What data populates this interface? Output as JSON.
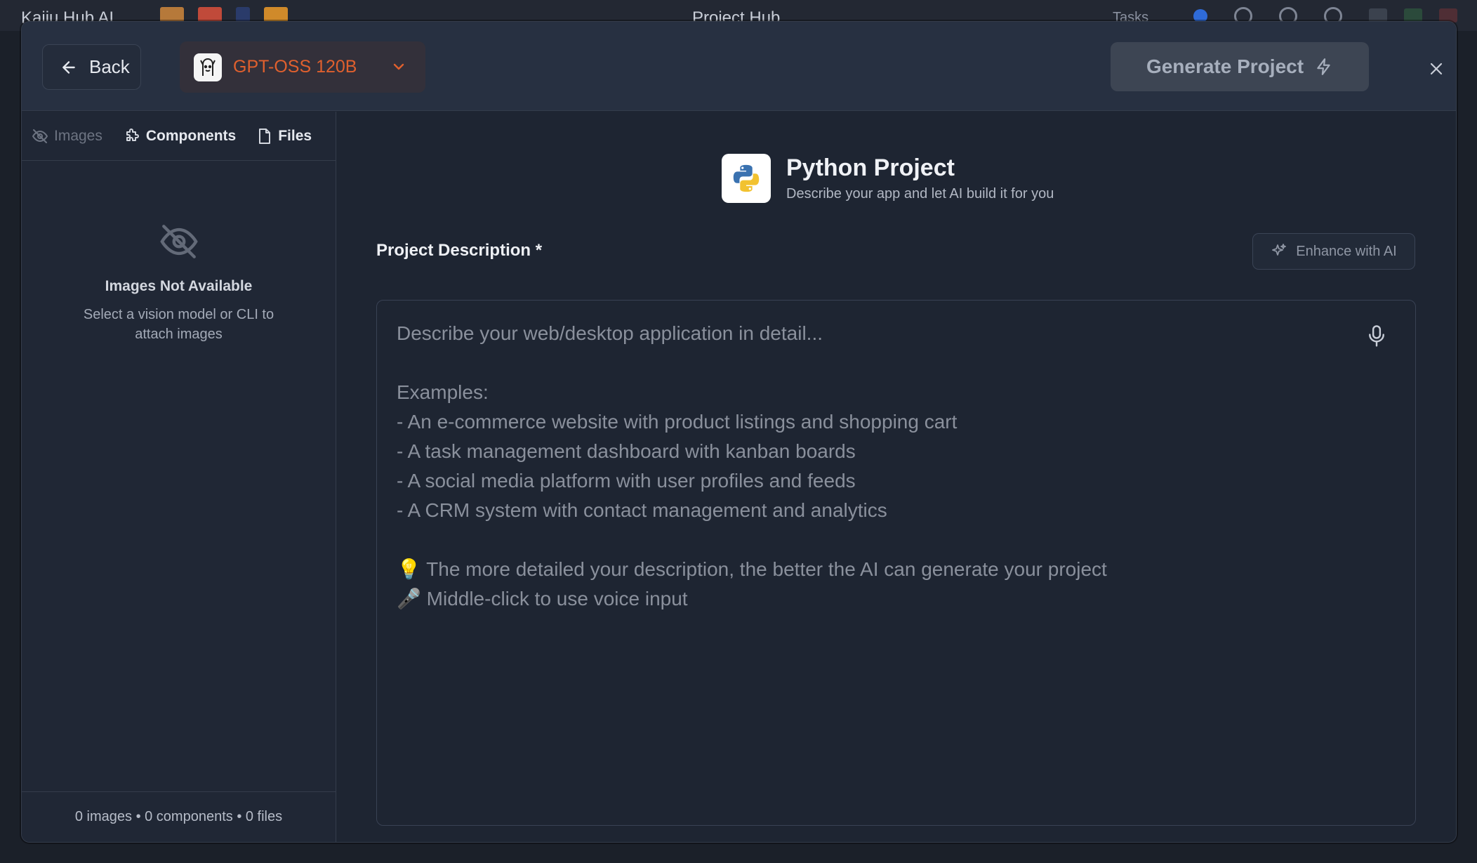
{
  "app": {
    "title": "Kaiju Hub AI",
    "center_title": "Project Hub",
    "tasks_label": "Tasks"
  },
  "header": {
    "back_label": "Back",
    "model_name": "GPT-OSS 120B",
    "generate_label": "Generate Project"
  },
  "sidebar": {
    "tabs": [
      {
        "label": "Images",
        "state": "disabled"
      },
      {
        "label": "Components",
        "state": "normal"
      },
      {
        "label": "Files",
        "state": "normal"
      }
    ],
    "empty_title": "Images Not Available",
    "empty_sub": "Select a vision model or CLI to attach images",
    "footer": "0 images • 0 components • 0 files"
  },
  "main": {
    "project_title": "Python Project",
    "project_subtitle": "Describe your app and let AI build it for you",
    "description_label": "Project Description *",
    "enhance_label": "Enhance with AI",
    "placeholder_lines": [
      "Describe your web/desktop application in detail...",
      "",
      "Examples:",
      "- An e-commerce website with product listings and shopping cart",
      "- A task management dashboard with kanban boards",
      "- A social media platform with user profiles and feeds",
      "- A CRM system with contact management and analytics",
      "",
      "💡 The more detailed your description, the better the AI can generate your project",
      "🎤 Middle-click to use voice input"
    ]
  },
  "colors": {
    "accent_model": "#e0602e",
    "modal_bg": "#1f2633",
    "header_bg": "#273041"
  }
}
